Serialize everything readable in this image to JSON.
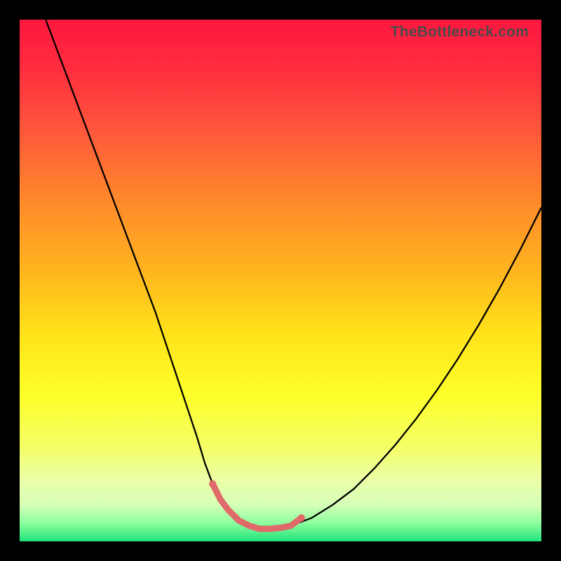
{
  "watermark": "TheBottleneck.com",
  "background": {
    "gradient_stops": [
      {
        "offset": 0.0,
        "color": "#ff173f"
      },
      {
        "offset": 0.1,
        "color": "#ff2f3f"
      },
      {
        "offset": 0.22,
        "color": "#ff5a3a"
      },
      {
        "offset": 0.35,
        "color": "#ff8a2a"
      },
      {
        "offset": 0.48,
        "color": "#ffb41f"
      },
      {
        "offset": 0.6,
        "color": "#ffe21a"
      },
      {
        "offset": 0.72,
        "color": "#fdff2a"
      },
      {
        "offset": 0.82,
        "color": "#f4ff66"
      },
      {
        "offset": 0.88,
        "color": "#ecffa6"
      },
      {
        "offset": 0.93,
        "color": "#d6ffb8"
      },
      {
        "offset": 0.965,
        "color": "#8dff9f"
      },
      {
        "offset": 1.0,
        "color": "#20e37a"
      }
    ]
  },
  "chart_data": {
    "type": "line",
    "title": "",
    "xlabel": "",
    "ylabel": "",
    "xlim": [
      0,
      100
    ],
    "ylim": [
      0,
      100
    ],
    "grid": false,
    "legend": false,
    "series": [
      {
        "name": "bottleneck-curve",
        "stroke": "#000000",
        "stroke_width": 2.3,
        "x": [
          5,
          8,
          11,
          14,
          17,
          20,
          23,
          26,
          28,
          30,
          32,
          34,
          35.5,
          37,
          38.5,
          40,
          42,
          44,
          46,
          48,
          52,
          56,
          60,
          64,
          68,
          72,
          76,
          80,
          84,
          88,
          92,
          96,
          100
        ],
        "y": [
          100,
          92,
          84,
          76,
          68,
          60,
          52,
          44,
          38,
          32,
          26,
          20,
          15,
          11,
          8,
          6,
          4,
          3,
          2.4,
          2.4,
          3,
          4.5,
          7,
          10,
          14,
          18.5,
          23.5,
          29,
          35,
          41.5,
          48.5,
          56,
          64
        ]
      },
      {
        "name": "valley-highlight",
        "stroke": "#e06a6a",
        "stroke_width": 9,
        "linecap": "round",
        "x": [
          37,
          38.5,
          40,
          42,
          44,
          46,
          48,
          50,
          52,
          54
        ],
        "y": [
          11,
          8,
          6,
          4,
          3,
          2.4,
          2.4,
          2.6,
          3,
          4.5
        ]
      }
    ],
    "highlight_caps": [
      {
        "x": 37,
        "y": 11,
        "r": 5.2,
        "fill": "#e06a6a"
      },
      {
        "x": 54,
        "y": 4.5,
        "r": 5.2,
        "fill": "#e06a6a"
      }
    ]
  }
}
